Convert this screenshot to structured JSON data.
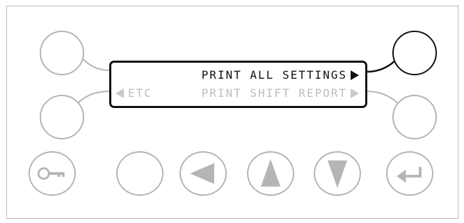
{
  "display": {
    "line1": {
      "text": "PRINT ALL SETTINGS",
      "active": true,
      "arrow": "right-arrow"
    },
    "line2": {
      "left_text": "ETC",
      "text": "PRINT SHIFT REPORT",
      "active": false,
      "arrows": [
        "left-arrow",
        "right-arrow"
      ]
    }
  },
  "buttons": {
    "soft_left_top": {
      "icon": "none"
    },
    "soft_left_bottom": {
      "icon": "none"
    },
    "soft_right_top": {
      "icon": "none",
      "state": "selected"
    },
    "soft_right_bottom": {
      "icon": "none"
    },
    "key": {
      "icon": "key-icon"
    },
    "blank": {
      "icon": "none"
    },
    "left": {
      "icon": "left-arrow-icon"
    },
    "up": {
      "icon": "up-arrow-icon"
    },
    "down": {
      "icon": "down-arrow-icon"
    },
    "enter": {
      "icon": "enter-icon"
    }
  },
  "colors": {
    "active_text": "#111111",
    "inactive_text": "#bdbdbd",
    "button_outline": "#b5b5b5",
    "selected_outline": "#111111"
  }
}
